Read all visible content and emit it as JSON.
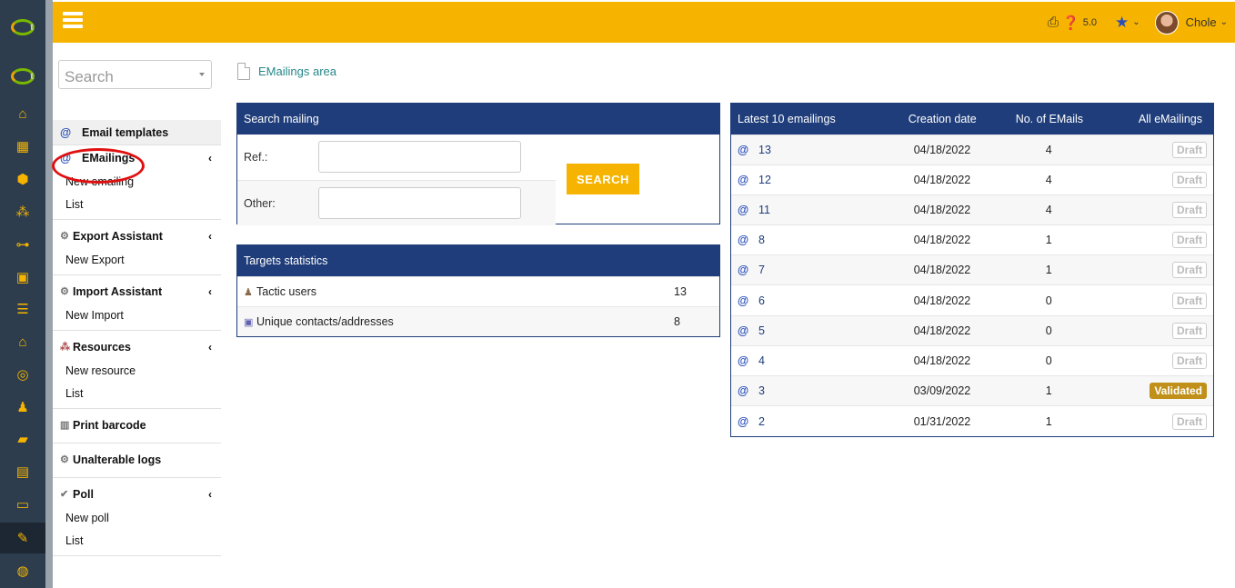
{
  "topbar": {
    "version": "5.0",
    "user_name": "Chole",
    "icons": [
      "menu-icon",
      "print-icon",
      "help-icon",
      "star-icon",
      "chevron-down-icon"
    ],
    "accent": "#f6b400"
  },
  "rail": {
    "icons": [
      "logo-icon",
      "home-icon",
      "building-icon",
      "box-icon",
      "cubes-icon",
      "sitemap-icon",
      "briefcase-icon",
      "database-icon",
      "bank-icon",
      "search-dollar-icon",
      "user-icon",
      "folder-open-icon",
      "calendar-icon",
      "ticket-icon",
      "wrench-icon",
      "globe-icon"
    ]
  },
  "search": {
    "placeholder": "Search"
  },
  "menu": {
    "email_templates": "Email templates",
    "emailings": "EMailings",
    "new_emailing": "New emailing",
    "list": "List",
    "export_assistant": "Export Assistant",
    "new_export": "New Export",
    "import_assistant": "Import Assistant",
    "new_import": "New Import",
    "resources": "Resources",
    "new_resource": "New resource",
    "print_barcode": "Print barcode",
    "unalterable_logs": "Unalterable logs",
    "poll": "Poll",
    "new_poll": "New poll"
  },
  "breadcrumb": "EMailings area",
  "search_panel": {
    "title": "Search mailing",
    "ref_label": "Ref.:",
    "other_label": "Other:",
    "ref_value": "",
    "other_value": "",
    "button": "SEARCH"
  },
  "targets": {
    "title": "Targets statistics",
    "rows": [
      {
        "label": "Tactic users",
        "value": "13"
      },
      {
        "label": "Unique contacts/addresses",
        "value": "8"
      }
    ]
  },
  "latest": {
    "col_title": "Latest 10 emailings",
    "col_date": "Creation date",
    "col_count": "No. of EMails",
    "col_all": "All eMailings",
    "rows": [
      {
        "ref": "13",
        "date": "04/18/2022",
        "count": "4",
        "status": "Draft"
      },
      {
        "ref": "12",
        "date": "04/18/2022",
        "count": "4",
        "status": "Draft"
      },
      {
        "ref": "11",
        "date": "04/18/2022",
        "count": "4",
        "status": "Draft"
      },
      {
        "ref": "8",
        "date": "04/18/2022",
        "count": "1",
        "status": "Draft"
      },
      {
        "ref": "7",
        "date": "04/18/2022",
        "count": "1",
        "status": "Draft"
      },
      {
        "ref": "6",
        "date": "04/18/2022",
        "count": "0",
        "status": "Draft"
      },
      {
        "ref": "5",
        "date": "04/18/2022",
        "count": "0",
        "status": "Draft"
      },
      {
        "ref": "4",
        "date": "04/18/2022",
        "count": "0",
        "status": "Draft"
      },
      {
        "ref": "3",
        "date": "03/09/2022",
        "count": "1",
        "status": "Validated"
      },
      {
        "ref": "2",
        "date": "01/31/2022",
        "count": "1",
        "status": "Draft"
      }
    ]
  }
}
